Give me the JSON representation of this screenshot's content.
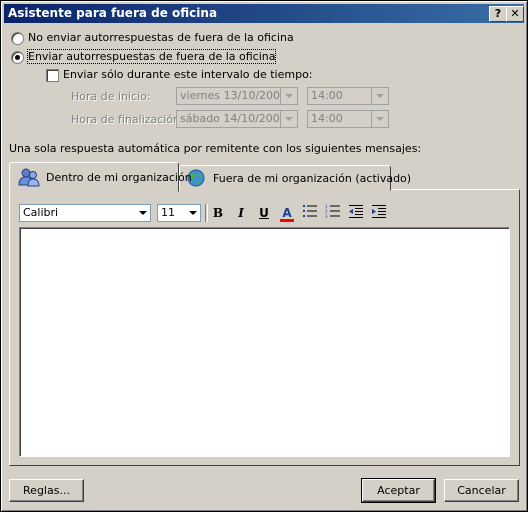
{
  "window": {
    "title": "Asistente para fuera de oficina",
    "help_label": "?",
    "close_label": "✕"
  },
  "options": {
    "no_send_label": "No enviar autorrespuestas de fuera de la oficina",
    "send_label": "Enviar autorrespuestas de fuera de la oficina",
    "selected": "send",
    "interval_label": "Enviar sólo durante este intervalo de tiempo:",
    "interval_checked": false
  },
  "schedule": {
    "start_label": "Hora de inicio:",
    "start_date": "viernes 13/10/2006",
    "start_time": "14:00",
    "end_label": "Hora de finalización:",
    "end_date": "sábado 14/10/2006",
    "end_time": "14:00"
  },
  "reply_section_label": "Una sola respuesta automática por remitente con los siguientes mensajes:",
  "tabs": [
    {
      "label": "Dentro de mi organización",
      "active": true
    },
    {
      "label": "Fuera de mi organización (activado)",
      "active": false
    }
  ],
  "formatting": {
    "font": "Calibri",
    "size": "11",
    "bold": "B",
    "italic": "I",
    "underline": "U",
    "font_color": "A",
    "font_color_hex": "#ff0000"
  },
  "buttons": {
    "rules": "Reglas...",
    "ok": "Aceptar",
    "cancel": "Cancelar"
  }
}
